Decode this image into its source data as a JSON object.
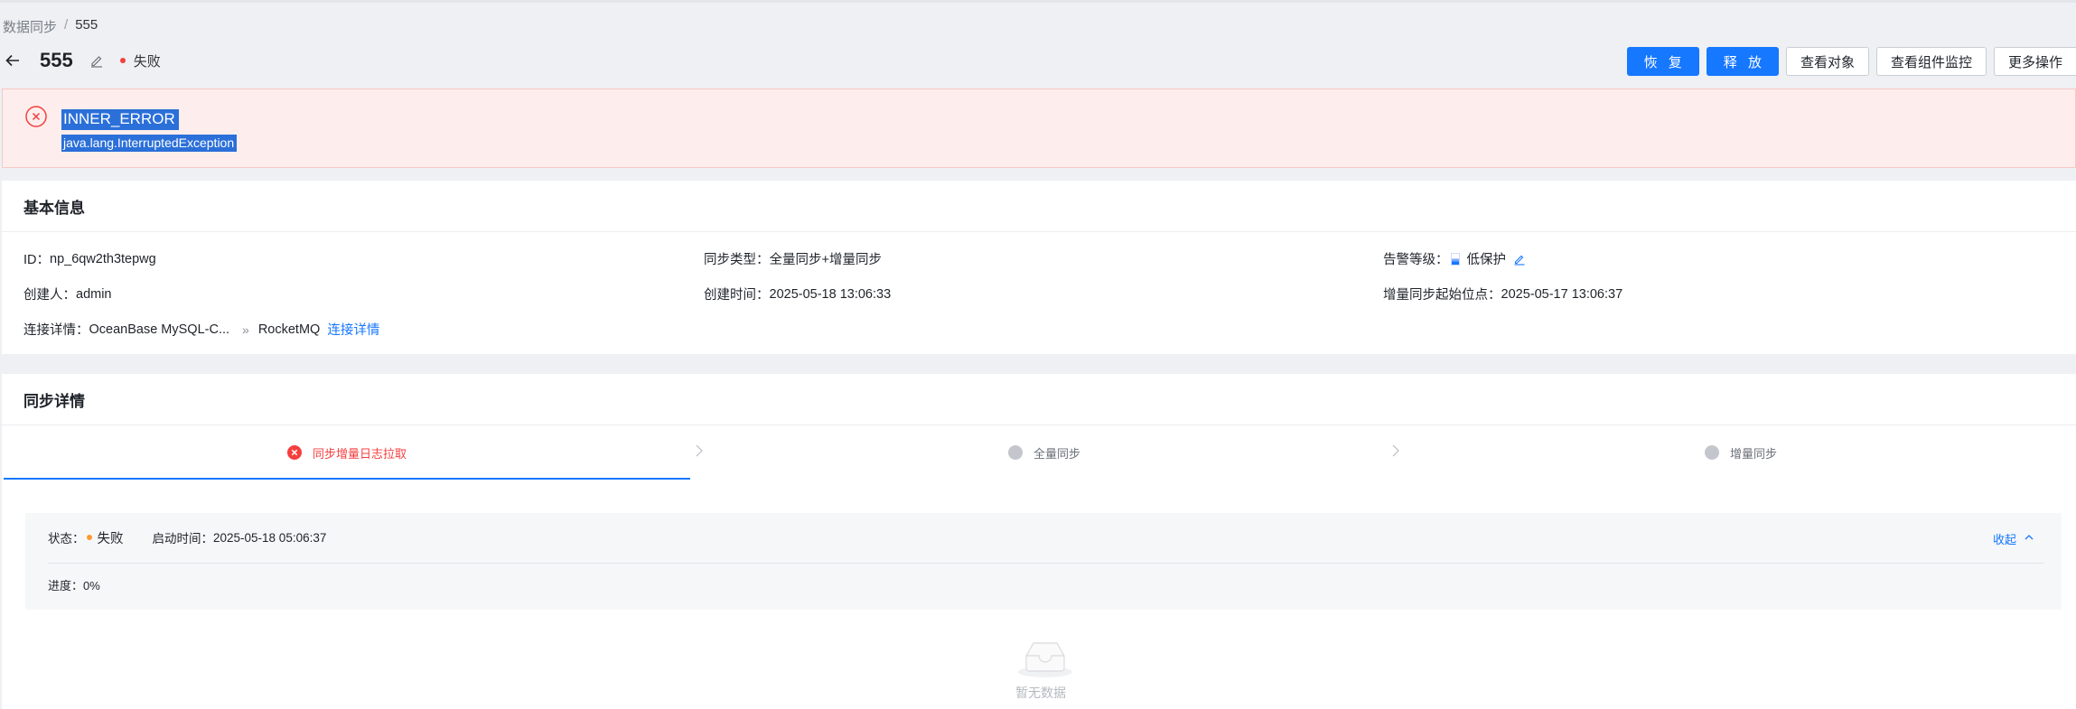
{
  "breadcrumb": {
    "parent": "数据同步",
    "separator": "/",
    "current": "555"
  },
  "header": {
    "title": "555",
    "status": "失败",
    "status_color": "#f53f3f",
    "actions": {
      "resume": "恢 复",
      "release": "释 放",
      "view_objects": "查看对象",
      "view_monitor": "查看组件监控",
      "more": "更多操作"
    }
  },
  "alert": {
    "title": "INNER_ERROR",
    "message": "java.lang.InterruptedException"
  },
  "basic_info": {
    "heading": "基本信息",
    "id_label": "ID：",
    "id_value": "np_6qw2th3tepwg",
    "sync_type_label": "同步类型：",
    "sync_type_value": "全量同步+增量同步",
    "alert_level_label": "告警等级：",
    "alert_level_value": "低保护",
    "creator_label": "创建人：",
    "creator_value": "admin",
    "created_time_label": "创建时间：",
    "created_time_value": "2025-05-18 13:06:33",
    "incr_start_label": "增量同步起始位点：",
    "incr_start_value": "2025-05-17 13:06:37",
    "connection_label": "连接详情：",
    "source": "OceanBase MySQL-C...",
    "arrow": "»",
    "target": "RocketMQ",
    "connection_link": "连接详情"
  },
  "sync_detail": {
    "heading": "同步详情",
    "steps": [
      {
        "label": "同步增量日志拉取",
        "state": "error"
      },
      {
        "label": "全量同步",
        "state": "pending"
      },
      {
        "label": "增量同步",
        "state": "pending"
      }
    ],
    "status_label": "状态：",
    "status_value": "失败",
    "start_time_label": "启动时间：",
    "start_time_value": "2025-05-18 05:06:37",
    "progress_label": "进度：",
    "progress_value": "0%",
    "collapse_label": "收起",
    "empty_text": "暂无数据"
  },
  "colors": {
    "primary": "#1677ff",
    "error": "#f53f3f",
    "warning": "#ff9a2e"
  }
}
